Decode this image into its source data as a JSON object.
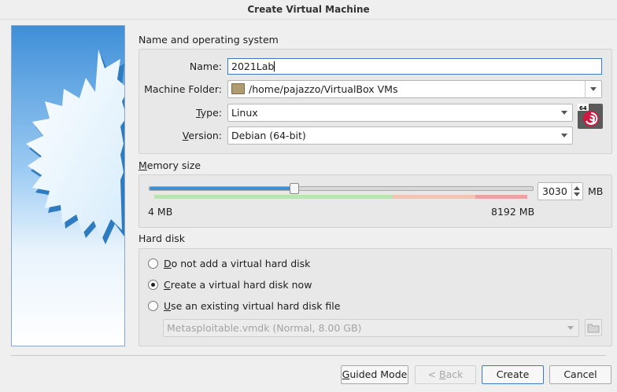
{
  "window": {
    "title": "Create Virtual Machine"
  },
  "name_os": {
    "section_label": "Name and operating system",
    "name_label": "Name:",
    "name_value": "2021Lab",
    "folder_label": "Machine Folder:",
    "folder_value": "/home/pajazzo/VirtualBox VMs",
    "type_label_accel": "T",
    "type_label_rest": "ype:",
    "type_value": "Linux",
    "version_label_accel": "V",
    "version_label_rest": "ersion:",
    "version_value": "Debian (64-bit)",
    "os_icon_badge": "64",
    "os_icon": "debian-swirl-icon"
  },
  "memory": {
    "section_label_accel": "M",
    "section_label_rest": "emory size",
    "value": "3030",
    "value_mb": 3030,
    "unit": "MB",
    "min_label": "4 MB",
    "max_label": "8192 MB",
    "slider_fraction": 0.37
  },
  "hard_disk": {
    "section_label": "Hard disk",
    "options": [
      {
        "accel": "D",
        "rest": "o not add a virtual hard disk",
        "checked": false
      },
      {
        "accel": "C",
        "rest": "reate a virtual hard disk now",
        "checked": true
      },
      {
        "accel": "U",
        "rest": "se an existing virtual hard disk file",
        "checked": false
      }
    ],
    "existing_file": "Metasploitable.vmdk (Normal, 8.00 GB)"
  },
  "buttons": {
    "guided_accel": "G",
    "guided_rest": "uided Mode",
    "back_prefix": "< ",
    "back_accel": "B",
    "back_rest": "ack",
    "create": "Create",
    "cancel": "Cancel"
  },
  "colors": {
    "accent": "#3c78c4",
    "slider_fill": "#3f8fd2",
    "zone_green": "#b9e6b0",
    "zone_orange": "#f2c4b4",
    "zone_red": "#eaa3a3"
  }
}
